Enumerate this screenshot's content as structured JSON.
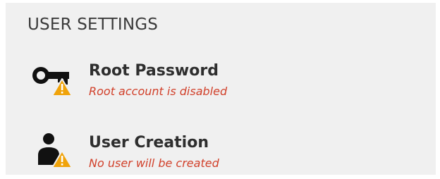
{
  "section": {
    "title": "USER SETTINGS"
  },
  "spokes": [
    {
      "title": "Root Password",
      "status": "Root account is disabled",
      "icon": "key-icon",
      "badge": "warning-icon"
    },
    {
      "title": "User Creation",
      "status": "No user will be created",
      "icon": "user-icon",
      "badge": "warning-icon"
    }
  ],
  "colors": {
    "panel_bg": "#f0f0f0",
    "title": "#2e2e2e",
    "status_error": "#d1402a",
    "warning": "#f0a30a",
    "icon": "#111111"
  }
}
